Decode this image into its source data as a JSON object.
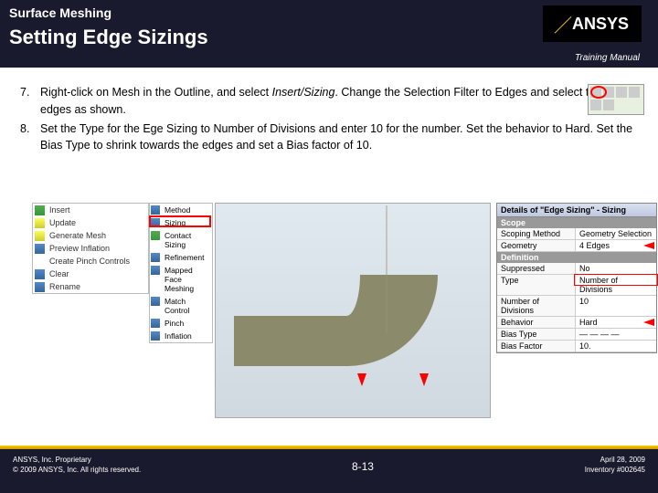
{
  "header": {
    "section": "Surface Meshing",
    "title": "Setting Edge Sizings",
    "logo_text": "ANSYS",
    "training_manual": "Training Manual"
  },
  "steps": [
    {
      "num": "7.",
      "text_parts": [
        "Right-click on Mesh in the Outline, and select ",
        "Insert/Sizing",
        ". Change the Selection Filter to Edges and select the 4 edges as shown."
      ]
    },
    {
      "num": "8.",
      "text": "Set the Type for the Ege Sizing to Number of Divisions and enter 10 for the number. Set the behavior to Hard. Set the Bias Type to shrink towards the edges and set a Bias factor of 10."
    }
  ],
  "context_menu": {
    "items": [
      "Insert",
      "Update",
      "Generate Mesh",
      "Preview Inflation",
      "Create Pinch Controls",
      "Clear",
      "Rename"
    ]
  },
  "sub_menu": {
    "items": [
      "Method",
      "Sizing",
      "Contact Sizing",
      "Refinement",
      "Mapped Face Meshing",
      "Match Control",
      "Pinch",
      "Inflation"
    ]
  },
  "details": {
    "header": "Details of \"Edge Sizing\" - Sizing",
    "sections": [
      {
        "name": "Scope",
        "rows": [
          {
            "label": "Scoping Method",
            "value": "Geometry Selection"
          },
          {
            "label": "Geometry",
            "value": "4 Edges"
          }
        ]
      },
      {
        "name": "Definition",
        "rows": [
          {
            "label": "Suppressed",
            "value": "No"
          },
          {
            "label": "Type",
            "value": "Number of Divisions"
          },
          {
            "label": "Number of Divisions",
            "value": "10"
          },
          {
            "label": "Behavior",
            "value": "Hard"
          },
          {
            "label": "Bias Type",
            "value": "— — — —"
          },
          {
            "label": "Bias Factor",
            "value": "10."
          }
        ]
      }
    ]
  },
  "footer": {
    "proprietary": "ANSYS, Inc. Proprietary",
    "copyright": "© 2009 ANSYS, Inc. All rights reserved.",
    "page_number": "8-13",
    "date": "April 28, 2009",
    "inventory": "Inventory #002645"
  }
}
